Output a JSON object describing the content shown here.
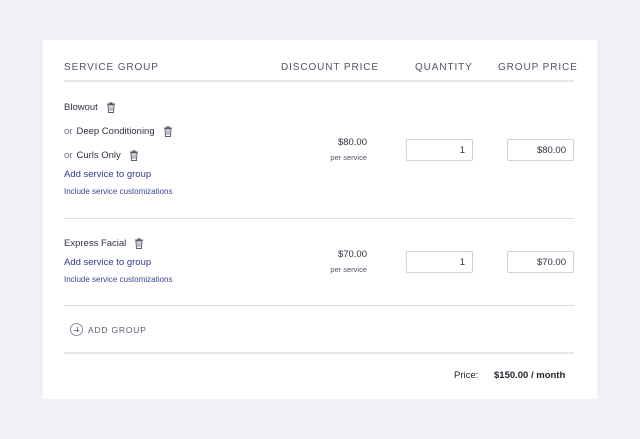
{
  "header": {
    "service_group": "SERVICE GROUP",
    "discount_price": "DISCOUNT PRICE",
    "quantity": "QUANTITY",
    "group_price": "GROUP PRICE"
  },
  "groups": [
    {
      "services": [
        {
          "prefix": "",
          "name": "Blowout"
        },
        {
          "prefix": "or",
          "name": "Deep Conditioning"
        },
        {
          "prefix": "or",
          "name": "Curls Only"
        }
      ],
      "add_service": "Add service to group",
      "customizations": "Include service customizations",
      "discount_price": "$80.00",
      "per_service": "per service",
      "quantity": "1",
      "group_price": "$80.00"
    },
    {
      "services": [
        {
          "prefix": "",
          "name": "Express Facial"
        }
      ],
      "add_service": "Add service to group",
      "customizations": "Include service customizations",
      "discount_price": "$70.00",
      "per_service": "per service",
      "quantity": "1",
      "group_price": "$70.00"
    }
  ],
  "add_group": "ADD GROUP",
  "footer": {
    "price_label": "Price:",
    "price_value": "$150.00 / month"
  },
  "icons": {
    "trash": "trash-icon",
    "plus": "plus-circle-icon"
  }
}
